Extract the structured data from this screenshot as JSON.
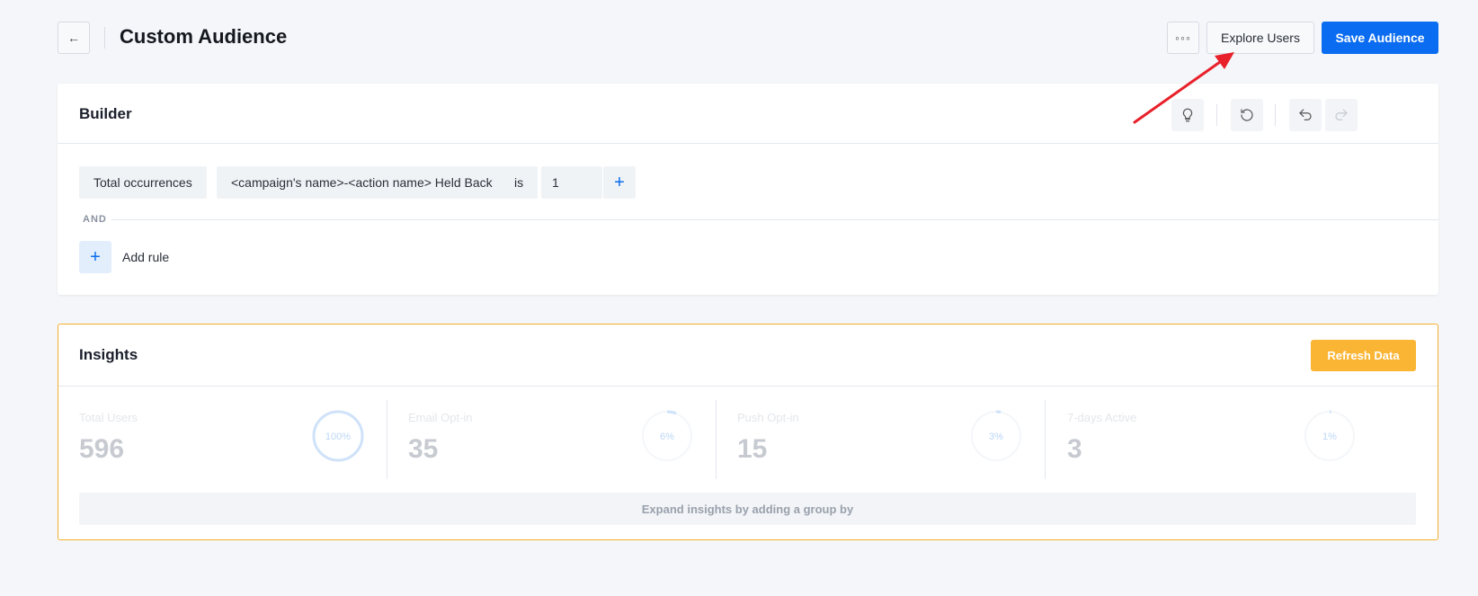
{
  "header": {
    "back_icon": "←",
    "title": "Custom Audience",
    "more_icon": "◦◦◦",
    "explore_label": "Explore Users",
    "save_label": "Save Audience"
  },
  "builder": {
    "title": "Builder",
    "tools": [
      "lightbulb-icon",
      "reset-icon",
      "undo-icon",
      "redo-icon"
    ],
    "rule": {
      "field": "Total occurrences",
      "event": "<campaign's name>-<action name> Held Back",
      "operator": "is",
      "value": "1",
      "add_value_icon": "+"
    },
    "and_label": "AND",
    "add_rule_icon": "+",
    "add_rule_label": "Add rule"
  },
  "insights": {
    "title": "Insights",
    "refresh_label": "Refresh Data",
    "stats": [
      {
        "label": "Total Users",
        "value": "596",
        "percent_label": "100%",
        "percent": 1.0
      },
      {
        "label": "Email Opt-in",
        "value": "35",
        "percent_label": "6%",
        "percent": 0.06
      },
      {
        "label": "Push Opt-in",
        "value": "15",
        "percent_label": "3%",
        "percent": 0.03
      },
      {
        "label": "7-days Active",
        "value": "3",
        "percent_label": "1%",
        "percent": 0.01
      }
    ],
    "expand_label": "Expand insights by adding a group by"
  },
  "colors": {
    "primary": "#0a6cf0",
    "warning": "#fbb534",
    "annotation": "#e8202a",
    "ring": "#cfe2fa"
  }
}
